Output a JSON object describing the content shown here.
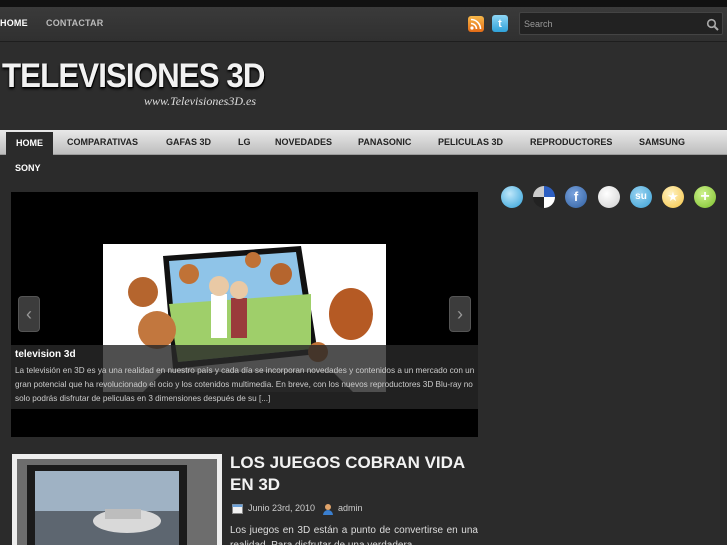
{
  "top_nav": {
    "items": [
      {
        "label": "HOME"
      },
      {
        "label": "CONTACTAR"
      }
    ]
  },
  "search": {
    "placeholder": "Search"
  },
  "site": {
    "title": "TELEVISIONES 3D",
    "url_tagline": "www.Televisiones3D.es"
  },
  "main_nav": {
    "items": [
      {
        "label": "HOME"
      },
      {
        "label": "COMPARATIVAS"
      },
      {
        "label": "GAFAS 3D"
      },
      {
        "label": "LG"
      },
      {
        "label": "NOVEDADES"
      },
      {
        "label": "PANASONIC"
      },
      {
        "label": "PELICULAS 3D"
      },
      {
        "label": "REPRODUCTORES"
      },
      {
        "label": "SAMSUNG"
      },
      {
        "label": "SONY"
      }
    ]
  },
  "slider": {
    "caption_title": "television 3d",
    "caption_text": "La televisión en 3D es ya una realidad en nuestro país y cada día se incorporan novedades y contenidos a un mercado con un gran potencial que ha revolucionado el ocio y los cotenidos multimedia. En breve, con los nuevos reproductores 3D Blu-ray no solo podrás disfrutar de peliculas en 3 dimensiones después de su [...]"
  },
  "social_icons": [
    {
      "name": "twitter-icon",
      "color": "#2fa1d9"
    },
    {
      "name": "delicious-icon",
      "color": "#d0d0d0"
    },
    {
      "name": "facebook-icon",
      "color": "#2f5f9f"
    },
    {
      "name": "myspace-icon",
      "color": "#e8e8e8"
    },
    {
      "name": "stumbleupon-icon",
      "color": "#3aa0d5"
    },
    {
      "name": "favorite-icon",
      "color": "#f5c342"
    },
    {
      "name": "add-icon",
      "color": "#7bbf2a"
    }
  ],
  "post": {
    "title": "LOS JUEGOS COBRAN VIDA EN 3D",
    "date": "Junio 23rd, 2010",
    "author": "admin",
    "excerpt": "Los juegos en 3D están a punto de convertirse en una realidad. Para disfrutar de una verdadera"
  }
}
